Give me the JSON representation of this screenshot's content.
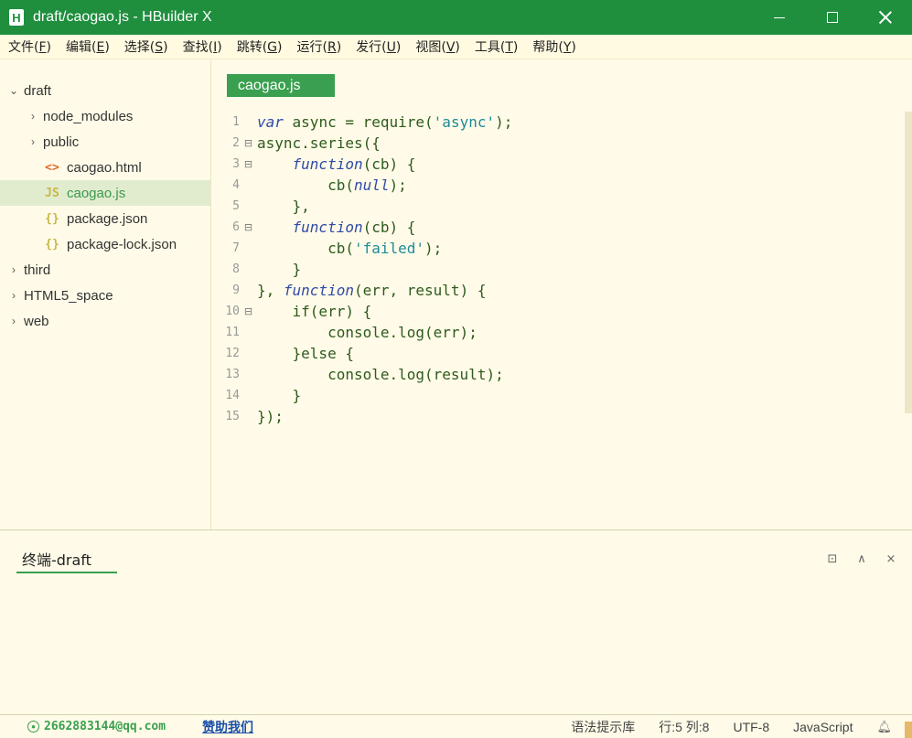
{
  "window": {
    "logo": "H",
    "title": "draft/caogao.js - HBuilder X"
  },
  "menu": [
    {
      "label": "文件(",
      "mnemonic": "F",
      "end": ")"
    },
    {
      "label": "编辑(",
      "mnemonic": "E",
      "end": ")"
    },
    {
      "label": "选择(",
      "mnemonic": "S",
      "end": ")"
    },
    {
      "label": "查找(",
      "mnemonic": "I",
      "end": ")"
    },
    {
      "label": "跳转(",
      "mnemonic": "G",
      "end": ")"
    },
    {
      "label": "运行(",
      "mnemonic": "R",
      "end": ")"
    },
    {
      "label": "发行(",
      "mnemonic": "U",
      "end": ")"
    },
    {
      "label": "视图(",
      "mnemonic": "V",
      "end": ")"
    },
    {
      "label": "工具(",
      "mnemonic": "T",
      "end": ")"
    },
    {
      "label": "帮助(",
      "mnemonic": "Y",
      "end": ")"
    }
  ],
  "sidebar": {
    "tree": [
      {
        "label": "draft",
        "chevron": "⌄"
      },
      {
        "label": "node_modules",
        "chevron": "›"
      },
      {
        "label": "public",
        "chevron": "›"
      },
      {
        "label": "caogao.html",
        "icon": "<>"
      },
      {
        "label": "caogao.js",
        "icon": "JS"
      },
      {
        "label": "package.json",
        "icon": "{}"
      },
      {
        "label": "package-lock.json",
        "icon": "{}"
      },
      {
        "label": "third",
        "chevron": "›"
      },
      {
        "label": "HTML5_space",
        "chevron": "›"
      },
      {
        "label": "web",
        "chevron": "›"
      }
    ]
  },
  "editor": {
    "tab": "caogao.js",
    "line_numbers": [
      "1",
      "2",
      "3",
      "4",
      "5",
      "6",
      "7",
      "8",
      "9",
      "10",
      "11",
      "12",
      "13",
      "14",
      "15"
    ]
  },
  "panel": {
    "tab": "终端-draft"
  },
  "status": {
    "email": "2662883144@qq.com",
    "donate": "赞助我们",
    "syntax_lib": "语法提示库",
    "position": "行:5  列:8",
    "encoding": "UTF-8",
    "language": "JavaScript"
  }
}
